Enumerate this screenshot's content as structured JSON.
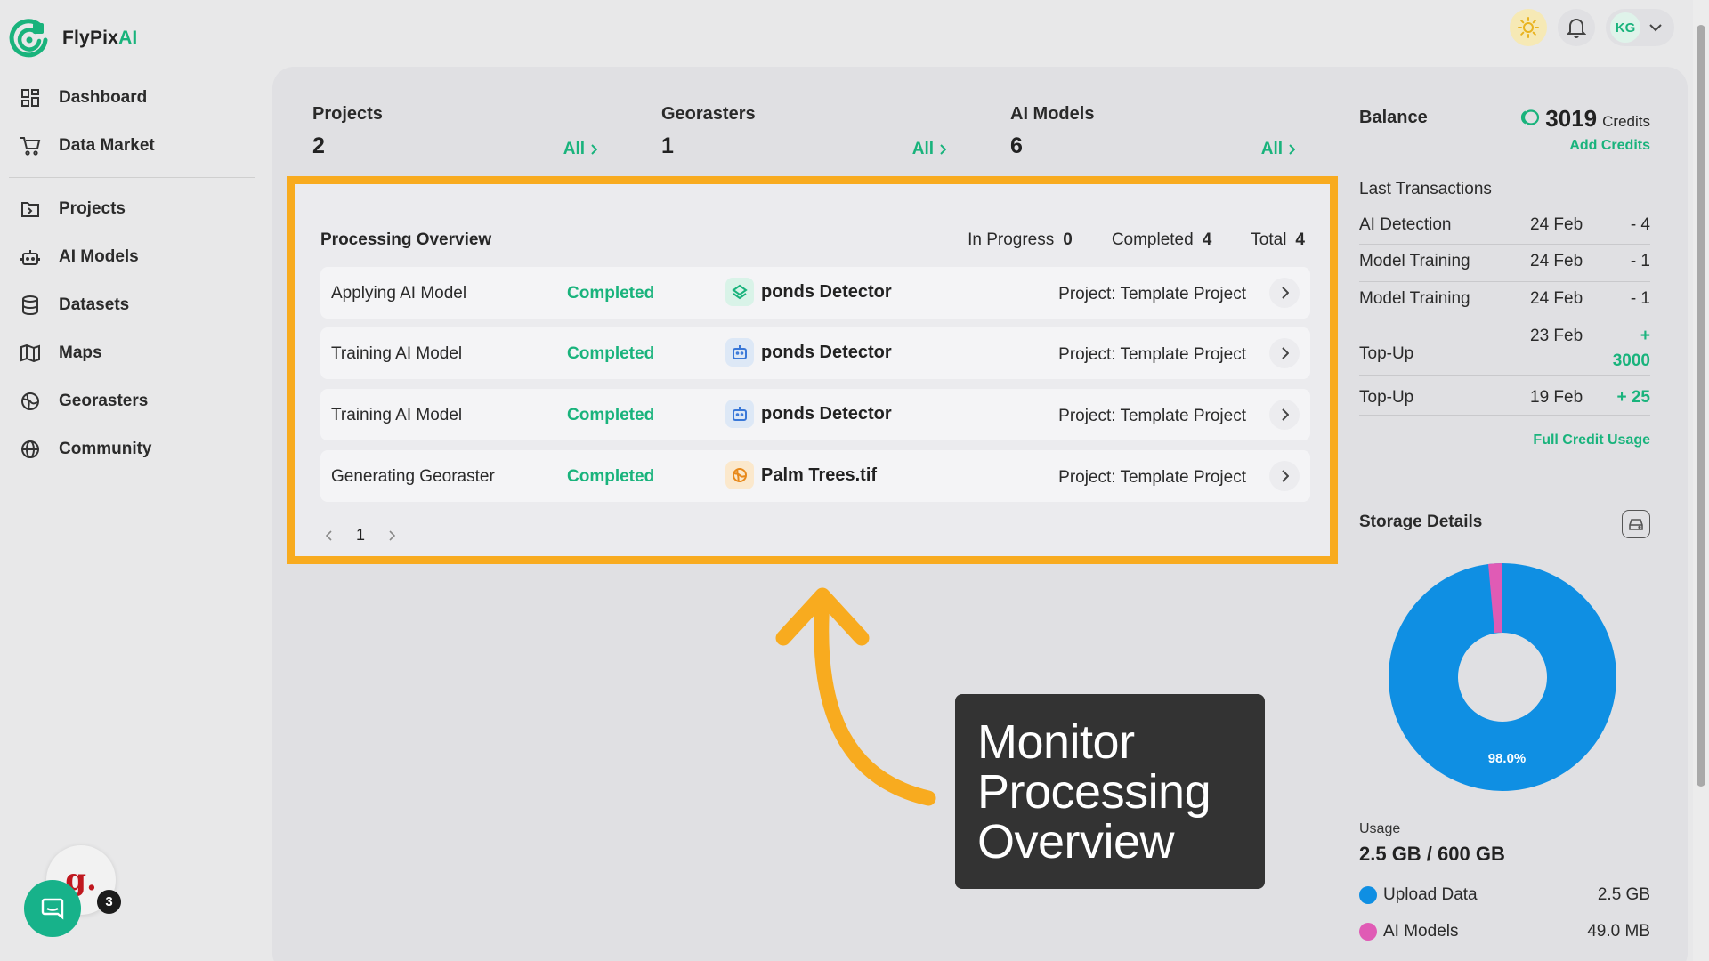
{
  "app": {
    "name_part1": "FlyPix",
    "name_part2": "AI"
  },
  "sidebar": {
    "items": [
      {
        "label": "Dashboard",
        "icon": "dashboard-icon"
      },
      {
        "label": "Data Market",
        "icon": "cart-icon"
      },
      {
        "label": "Projects",
        "icon": "folder-icon"
      },
      {
        "label": "AI Models",
        "icon": "robot-icon"
      },
      {
        "label": "Datasets",
        "icon": "database-icon"
      },
      {
        "label": "Maps",
        "icon": "map-icon"
      },
      {
        "label": "Georasters",
        "icon": "globe-grid-icon"
      },
      {
        "label": "Community",
        "icon": "globe-icon"
      }
    ]
  },
  "header": {
    "user_initials": "KG"
  },
  "stats": {
    "projects": {
      "label": "Projects",
      "value": "2",
      "all": "All"
    },
    "georasters": {
      "label": "Georasters",
      "value": "1",
      "all": "All"
    },
    "ai_models": {
      "label": "AI Models",
      "value": "6",
      "all": "All"
    }
  },
  "processing": {
    "title": "Processing Overview",
    "in_progress_label": "In Progress",
    "in_progress": "0",
    "completed_label": "Completed",
    "completed": "4",
    "total_label": "Total",
    "total": "4",
    "rows": [
      {
        "type": "Applying AI Model",
        "status": "Completed",
        "name": "ponds Detector",
        "project": "Project: Template Project",
        "icon": "layers-icon"
      },
      {
        "type": "Training AI Model",
        "status": "Completed",
        "name": "ponds Detector",
        "project": "Project: Template Project",
        "icon": "robot-icon"
      },
      {
        "type": "Training AI Model",
        "status": "Completed",
        "name": "ponds Detector",
        "project": "Project: Template Project",
        "icon": "robot-icon"
      },
      {
        "type": "Generating Georaster",
        "status": "Completed",
        "name": "Palm Trees.tif",
        "project": "Project: Template Project",
        "icon": "globe-icon"
      }
    ],
    "page": "1"
  },
  "annotation": {
    "line1": "Monitor",
    "line2": "Processing",
    "line3": "Overview"
  },
  "balance": {
    "label": "Balance",
    "value": "3019",
    "unit": "Credits",
    "add_credits": "Add Credits",
    "last_tx_title": "Last Transactions",
    "transactions": [
      {
        "name": "AI Detection",
        "date": "24 Feb",
        "amount": "- 4"
      },
      {
        "name": "Model Training",
        "date": "24 Feb",
        "amount": "- 1"
      },
      {
        "name": "Model Training",
        "date": "24 Feb",
        "amount": "- 1"
      },
      {
        "name": "Top-Up",
        "date": "23 Feb",
        "amount_line1": "+",
        "amount_line2": "3000"
      },
      {
        "name": "Top-Up",
        "date": "19 Feb",
        "amount": "+ 25"
      }
    ],
    "full_usage": "Full Credit Usage"
  },
  "storage": {
    "title": "Storage Details",
    "percent_label": "98.0%",
    "usage_label": "Usage",
    "usage_value": "2.5 GB / 600 GB",
    "legend": [
      {
        "name": "Upload Data",
        "value": "2.5 GB",
        "color": "#0f8fe3"
      },
      {
        "name": "AI Models",
        "value": "49.0 MB",
        "color": "#e05bb5"
      }
    ]
  },
  "chat": {
    "widget_letter": "g.",
    "badge_count": "3"
  },
  "colors": {
    "accent": "#19b37c",
    "highlight": "#f8ab1f",
    "donut_main": "#0f8fe3",
    "donut_minor": "#e05bb5"
  }
}
